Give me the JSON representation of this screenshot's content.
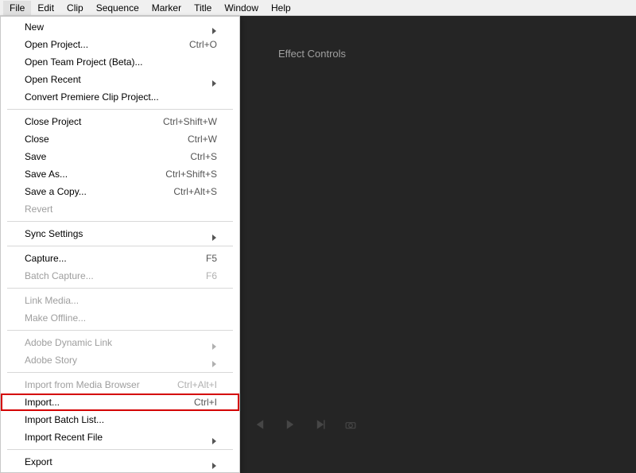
{
  "menubar": {
    "items": [
      "File",
      "Edit",
      "Clip",
      "Sequence",
      "Marker",
      "Title",
      "Window",
      "Help"
    ],
    "openIndex": 0
  },
  "fileMenu": {
    "groups": [
      [
        {
          "label": "New",
          "submenu": true
        },
        {
          "label": "Open Project...",
          "shortcut": "Ctrl+O"
        },
        {
          "label": "Open Team Project (Beta)..."
        },
        {
          "label": "Open Recent",
          "submenu": true
        },
        {
          "label": "Convert Premiere Clip Project..."
        }
      ],
      [
        {
          "label": "Close Project",
          "shortcut": "Ctrl+Shift+W"
        },
        {
          "label": "Close",
          "shortcut": "Ctrl+W"
        },
        {
          "label": "Save",
          "shortcut": "Ctrl+S"
        },
        {
          "label": "Save As...",
          "shortcut": "Ctrl+Shift+S"
        },
        {
          "label": "Save a Copy...",
          "shortcut": "Ctrl+Alt+S"
        },
        {
          "label": "Revert",
          "disabled": true
        }
      ],
      [
        {
          "label": "Sync Settings",
          "submenu": true
        }
      ],
      [
        {
          "label": "Capture...",
          "shortcut": "F5"
        },
        {
          "label": "Batch Capture...",
          "shortcut": "F6",
          "disabled": true
        }
      ],
      [
        {
          "label": "Link Media...",
          "disabled": true
        },
        {
          "label": "Make Offline...",
          "disabled": true
        }
      ],
      [
        {
          "label": "Adobe Dynamic Link",
          "submenu": true,
          "disabled": true
        },
        {
          "label": "Adobe Story",
          "submenu": true,
          "disabled": true
        }
      ],
      [
        {
          "label": "Import from Media Browser",
          "shortcut": "Ctrl+Alt+I",
          "disabled": true
        },
        {
          "label": "Import...",
          "shortcut": "Ctrl+I",
          "highlighted": true
        },
        {
          "label": "Import Batch List..."
        },
        {
          "label": "Import Recent File",
          "submenu": true
        }
      ],
      [
        {
          "label": "Export",
          "submenu": true
        }
      ]
    ]
  },
  "panel": {
    "label": "Effect Controls"
  }
}
